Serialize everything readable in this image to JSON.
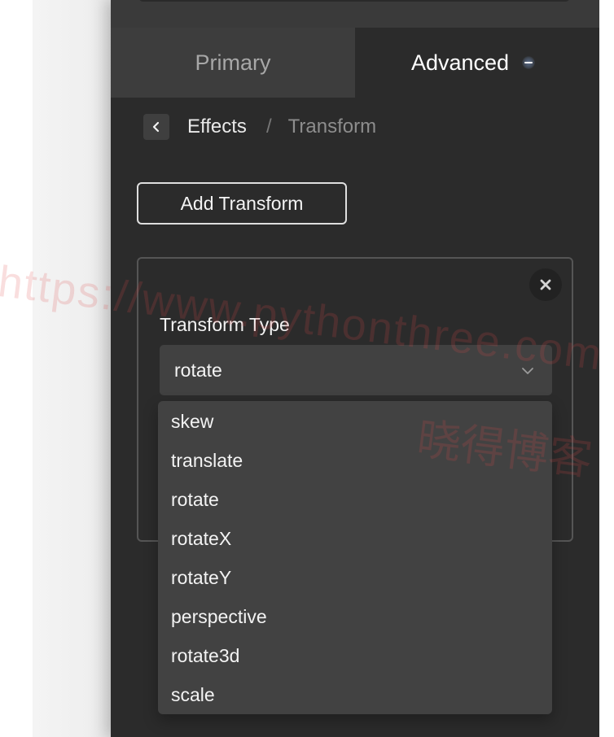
{
  "tabs": [
    {
      "label": "Primary",
      "selected": false
    },
    {
      "label": "Advanced",
      "selected": true
    }
  ],
  "breadcrumb": {
    "back_icon": "chevron-left-icon",
    "current": "Effects",
    "separator": "/",
    "next": "Transform"
  },
  "actions": {
    "add_transform": "Add Transform"
  },
  "transform_card": {
    "close_icon": "close-icon",
    "field_label": "Transform Type",
    "selected_value": "rotate",
    "chevron_icon": "chevron-down-icon"
  },
  "dropdown": {
    "options": [
      "skew",
      "translate",
      "rotate",
      "rotateX",
      "rotateY",
      "perspective",
      "rotate3d",
      "scale"
    ]
  },
  "watermark": {
    "url": "https://www.pythonthree.com",
    "chinese": "晓得博客"
  },
  "colors": {
    "panel_background": "#2b2b2b",
    "tab_inactive": "#3d3d3d",
    "dropdown_background": "#424242",
    "accent_glow": "#96beff"
  }
}
